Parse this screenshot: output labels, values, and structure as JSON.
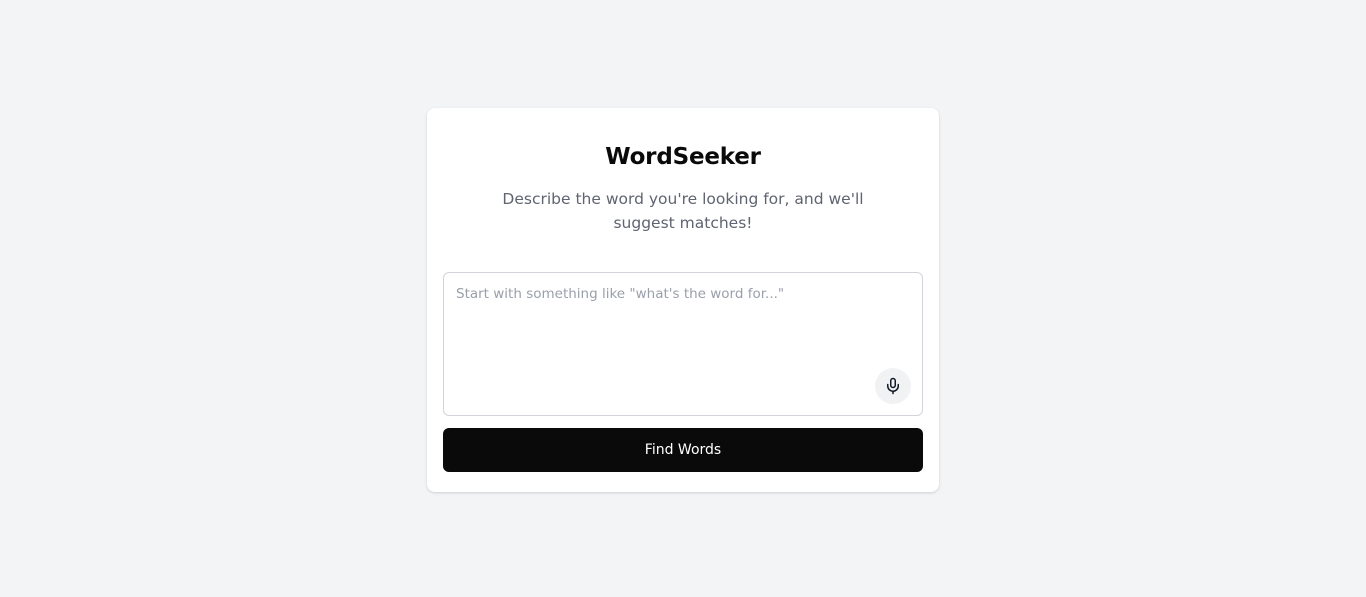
{
  "app": {
    "title": "WordSeeker",
    "subtitle": "Describe the word you're looking for, and we'll suggest matches!"
  },
  "search": {
    "value": "",
    "placeholder": "Start with something like \"what's the word for...\""
  },
  "actions": {
    "mic_icon": "microphone-icon",
    "submit_label": "Find Words"
  },
  "colors": {
    "background": "#f3f4f6",
    "card": "#ffffff",
    "primary_button": "#0a0a0b",
    "primary_button_text": "#ffffff",
    "muted_text": "#5f6470"
  }
}
